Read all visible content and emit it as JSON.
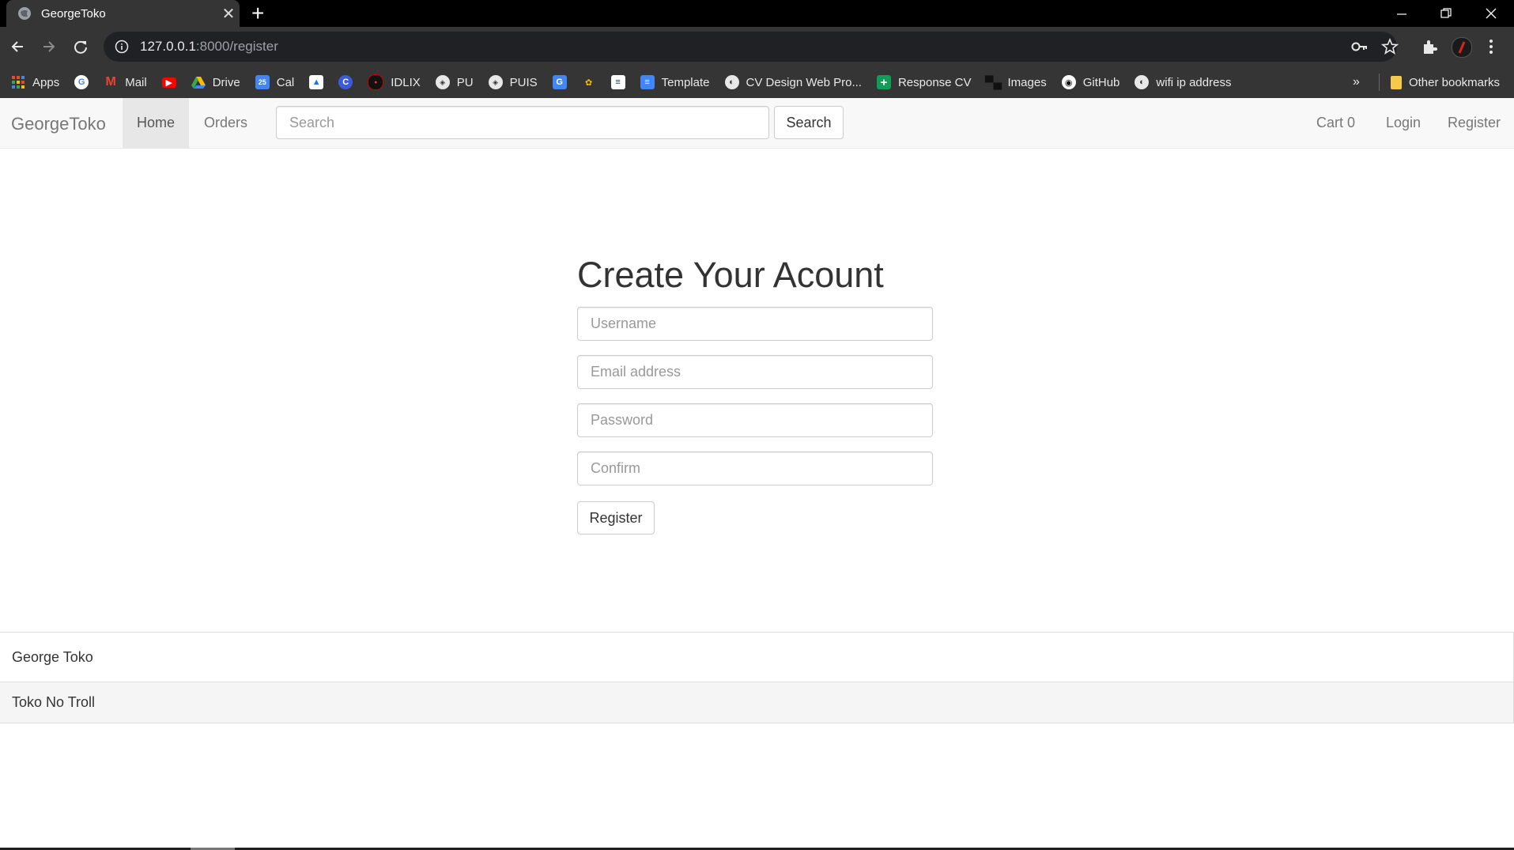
{
  "browser": {
    "tab_title": "GeorgeToko",
    "url_host": "127.0.0.1",
    "url_path": ":8000/register",
    "bookmarks": [
      "Apps",
      "Mail",
      "Drive",
      "Cal",
      "IDLIX",
      "PU",
      "PUIS",
      "Template",
      "CV Design Web Pro...",
      "Response CV",
      "Images",
      "GitHub",
      "wifi ip address"
    ],
    "other_bookmarks": "Other bookmarks"
  },
  "navbar": {
    "brand": "GeorgeToko",
    "home": "Home",
    "orders": "Orders",
    "search_placeholder": "Search",
    "search_button": "Search",
    "cart": "Cart 0",
    "login": "Login",
    "register": "Register"
  },
  "form": {
    "title": "Create Your Acount",
    "username_placeholder": "Username",
    "email_placeholder": "Email address",
    "password_placeholder": "Password",
    "confirm_placeholder": "Confirm",
    "submit": "Register"
  },
  "footer": {
    "line1": "George Toko",
    "line2": "Toko No Troll"
  }
}
